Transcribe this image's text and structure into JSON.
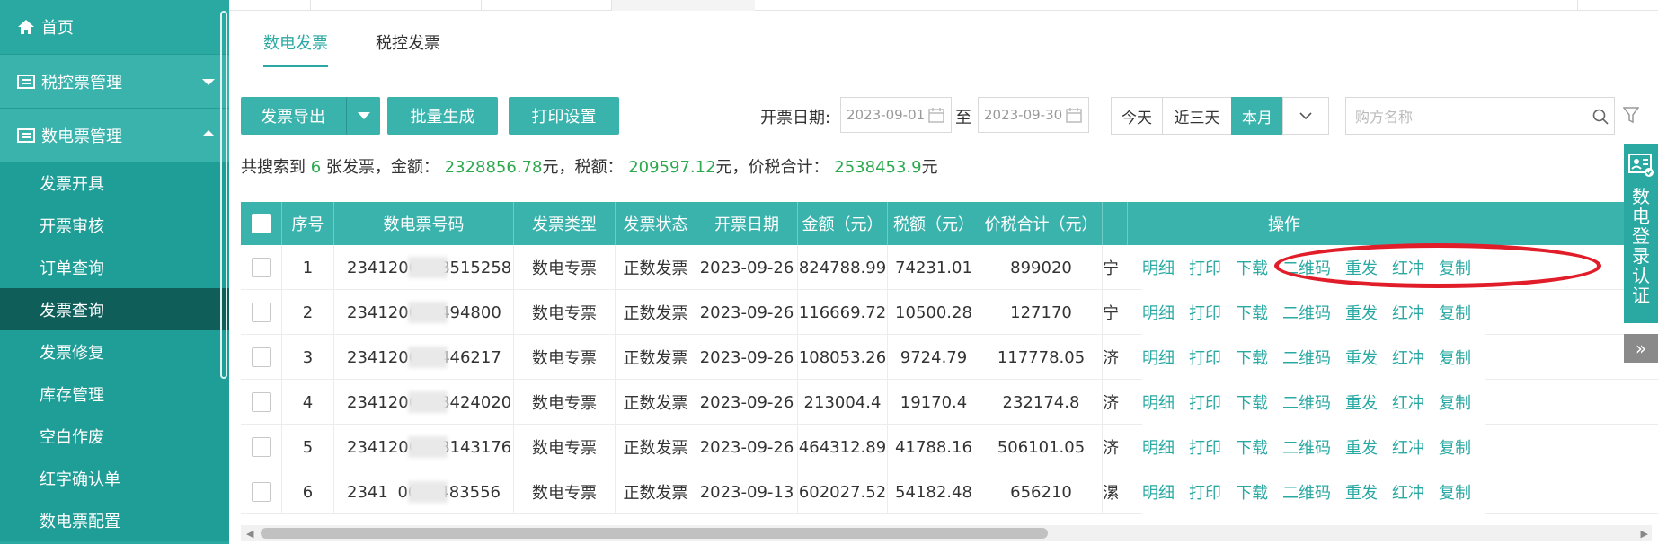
{
  "sidebar": {
    "home": "首页",
    "tax_control_group": "税控票管理",
    "digital_group": "数电票管理",
    "sub_items": [
      "发票开具",
      "开票审核",
      "订单查询",
      "发票查询",
      "发票修复",
      "库存管理",
      "空白作废",
      "红字确认单",
      "数电票配置"
    ],
    "active_index": 3
  },
  "tabs": [
    "数电发票",
    "税控发票"
  ],
  "toolbar": {
    "export_label": "发票导出",
    "batch_label": "批量生成",
    "print_settings_label": "打印设置",
    "date_label": "开票日期:",
    "date_from": "2023-09-01",
    "date_to_sep": "至",
    "date_to": "2023-09-30",
    "range_today": "今天",
    "range_3days": "近三天",
    "range_month": "本月",
    "search_placeholder": "购方名称"
  },
  "summary": {
    "prefix": "共搜索到",
    "count": "6",
    "count_suffix": "张发票，金额：",
    "amount": "2328856.78",
    "amount_suffix": "元，税额：",
    "tax": "209597.12",
    "tax_suffix": "元，价税合计：",
    "total": "2538453.9",
    "total_suffix": "元"
  },
  "table": {
    "headers": [
      "序号",
      "数电票号码",
      "发票类型",
      "发票状态",
      "开票日期",
      "金额（元）",
      "税额（元）",
      "价税合计（元）",
      "",
      "操作"
    ],
    "rows": [
      {
        "no": "1",
        "num_a": "2341200",
        "num_b": "028515258",
        "type": "数电专票",
        "status": "正数发票",
        "date": "2023-09-26",
        "amount": "824788.99",
        "tax": "74231.01",
        "total": "899020",
        "buyer": "宁"
      },
      {
        "no": "2",
        "num_a": "234120",
        "num_b": "028494800",
        "type": "数电专票",
        "status": "正数发票",
        "date": "2023-09-26",
        "amount": "116669.72",
        "tax": "10500.28",
        "total": "127170",
        "buyer": "宁"
      },
      {
        "no": "3",
        "num_a": "234120",
        "num_b": "028446217",
        "type": "数电专票",
        "status": "正数发票",
        "date": "2023-09-26",
        "amount": "108053.26",
        "tax": "9724.79",
        "total": "117778.05",
        "buyer": "济"
      },
      {
        "no": "4",
        "num_a": "234120",
        "num_b": "0028424020",
        "type": "数电专票",
        "status": "正数发票",
        "date": "2023-09-26",
        "amount": "213004.4",
        "tax": "19170.4",
        "total": "232174.8",
        "buyer": "济"
      },
      {
        "no": "5",
        "num_a": "23412",
        "num_b": "00028143176",
        "type": "数电专票",
        "status": "正数发票",
        "date": "2023-09-26",
        "amount": "464312.89",
        "tax": "41788.16",
        "total": "506101.05",
        "buyer": "济"
      },
      {
        "no": "6",
        "num_a": "2341",
        "num_b": "0021483556",
        "type": "数电专票",
        "status": "正数发票",
        "date": "2023-09-13",
        "amount": "602027.52",
        "tax": "54182.48",
        "total": "656210",
        "buyer": "漯"
      }
    ],
    "actions": [
      "明细",
      "打印",
      "下载",
      "二维码",
      "重发",
      "红冲",
      "复制"
    ]
  },
  "side_panel": {
    "label": "数电登录认证",
    "toggle": "»"
  },
  "colors": {
    "brand": "#2aa9a3",
    "active_sidebar": "#0f5e5a",
    "highlight_green": "#2da94f",
    "annotation_red": "#e11d2a"
  }
}
